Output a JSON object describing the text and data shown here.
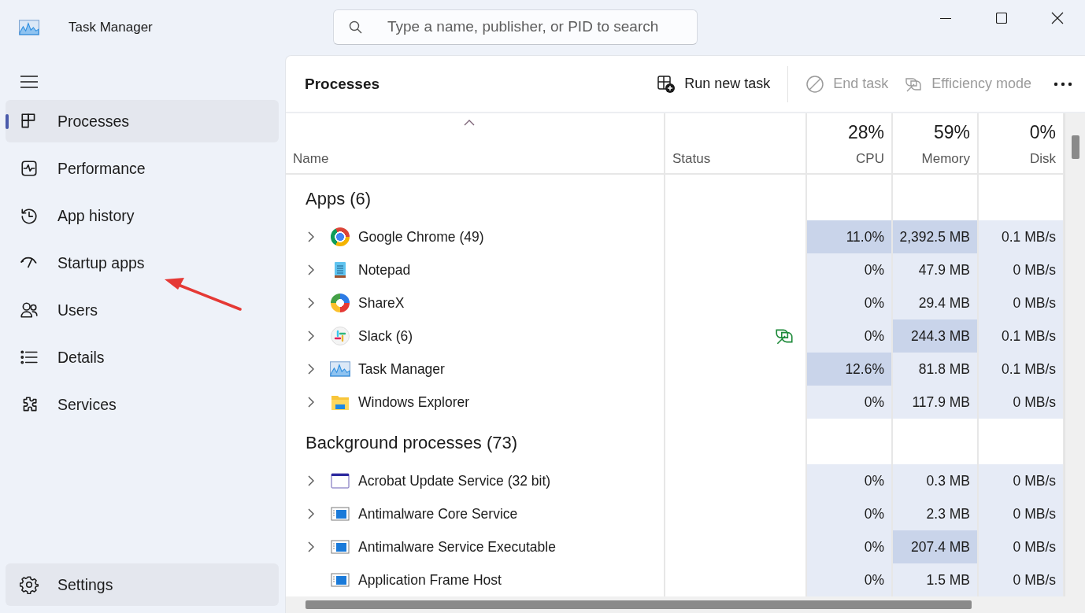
{
  "window": {
    "title": "Task Manager"
  },
  "search": {
    "placeholder": "Type a name, publisher, or PID to search"
  },
  "sidebar": {
    "items": [
      {
        "label": "Processes",
        "kind": "processes",
        "selected": true
      },
      {
        "label": "Performance",
        "kind": "performance",
        "selected": false
      },
      {
        "label": "App history",
        "kind": "history",
        "selected": false
      },
      {
        "label": "Startup apps",
        "kind": "startup",
        "selected": false
      },
      {
        "label": "Users",
        "kind": "users",
        "selected": false
      },
      {
        "label": "Details",
        "kind": "details",
        "selected": false
      },
      {
        "label": "Services",
        "kind": "services",
        "selected": false
      }
    ],
    "settings": {
      "label": "Settings"
    }
  },
  "toolbar": {
    "title": "Processes",
    "buttons": [
      {
        "label": "Run new task",
        "kind": "run",
        "disabled": false
      },
      {
        "label": "End task",
        "kind": "end",
        "disabled": true
      },
      {
        "label": "Efficiency mode",
        "kind": "efficiency",
        "disabled": true
      }
    ]
  },
  "table": {
    "columns": [
      {
        "label": "Name",
        "sorted": true
      },
      {
        "label": "Status",
        "sorted": false
      },
      {
        "label": "CPU",
        "total": "28%",
        "sorted": false
      },
      {
        "label": "Memory",
        "total": "59%",
        "sorted": false
      },
      {
        "label": "Disk",
        "total": "0%",
        "sorted": false
      }
    ],
    "groups": [
      {
        "title": "Apps (6)",
        "rows": [
          {
            "name": "Google Chrome (49)",
            "kind": "chrome",
            "expandable": true,
            "efficiency_mode": false,
            "cpu": {
              "text": "11.0%",
              "highlighted": true
            },
            "memory": {
              "text": "2,392.5 MB",
              "highlighted": true
            },
            "disk": {
              "text": "0.1 MB/s",
              "highlighted": false
            }
          },
          {
            "name": "Notepad",
            "kind": "notepad",
            "expandable": true,
            "efficiency_mode": false,
            "cpu": {
              "text": "0%",
              "highlighted": false
            },
            "memory": {
              "text": "47.9 MB",
              "highlighted": false
            },
            "disk": {
              "text": "0 MB/s",
              "highlighted": false
            }
          },
          {
            "name": "ShareX",
            "kind": "sharex",
            "expandable": true,
            "efficiency_mode": false,
            "cpu": {
              "text": "0%",
              "highlighted": false
            },
            "memory": {
              "text": "29.4 MB",
              "highlighted": false
            },
            "disk": {
              "text": "0 MB/s",
              "highlighted": false
            }
          },
          {
            "name": "Slack (6)",
            "kind": "slack",
            "expandable": true,
            "efficiency_mode": true,
            "cpu": {
              "text": "0%",
              "highlighted": false
            },
            "memory": {
              "text": "244.3 MB",
              "highlighted": true
            },
            "disk": {
              "text": "0.1 MB/s",
              "highlighted": false
            }
          },
          {
            "name": "Task Manager",
            "kind": "taskmanager",
            "expandable": true,
            "efficiency_mode": false,
            "cpu": {
              "text": "12.6%",
              "highlighted": true
            },
            "memory": {
              "text": "81.8 MB",
              "highlighted": false
            },
            "disk": {
              "text": "0.1 MB/s",
              "highlighted": false
            }
          },
          {
            "name": "Windows Explorer",
            "kind": "explorer",
            "expandable": true,
            "efficiency_mode": false,
            "cpu": {
              "text": "0%",
              "highlighted": false
            },
            "memory": {
              "text": "117.9 MB",
              "highlighted": false
            },
            "disk": {
              "text": "0 MB/s",
              "highlighted": false
            }
          }
        ]
      },
      {
        "title": "Background processes (73)",
        "rows": [
          {
            "name": "Acrobat Update Service (32 bit)",
            "kind": "window",
            "expandable": true,
            "efficiency_mode": false,
            "cpu": {
              "text": "0%",
              "highlighted": false
            },
            "memory": {
              "text": "0.3 MB",
              "highlighted": false
            },
            "disk": {
              "text": "0 MB/s",
              "highlighted": false
            }
          },
          {
            "name": "Antimalware Core Service",
            "kind": "service",
            "expandable": true,
            "efficiency_mode": false,
            "cpu": {
              "text": "0%",
              "highlighted": false
            },
            "memory": {
              "text": "2.3 MB",
              "highlighted": false
            },
            "disk": {
              "text": "0 MB/s",
              "highlighted": false
            }
          },
          {
            "name": "Antimalware Service Executable",
            "kind": "service",
            "expandable": true,
            "efficiency_mode": false,
            "cpu": {
              "text": "0%",
              "highlighted": false
            },
            "memory": {
              "text": "207.4 MB",
              "highlighted": true
            },
            "disk": {
              "text": "0 MB/s",
              "highlighted": false
            }
          },
          {
            "name": "Application Frame Host",
            "kind": "service",
            "expandable": false,
            "efficiency_mode": false,
            "cpu": {
              "text": "0%",
              "highlighted": false
            },
            "memory": {
              "text": "1.5 MB",
              "highlighted": false
            },
            "disk": {
              "text": "0 MB/s",
              "highlighted": false
            }
          }
        ]
      }
    ]
  }
}
